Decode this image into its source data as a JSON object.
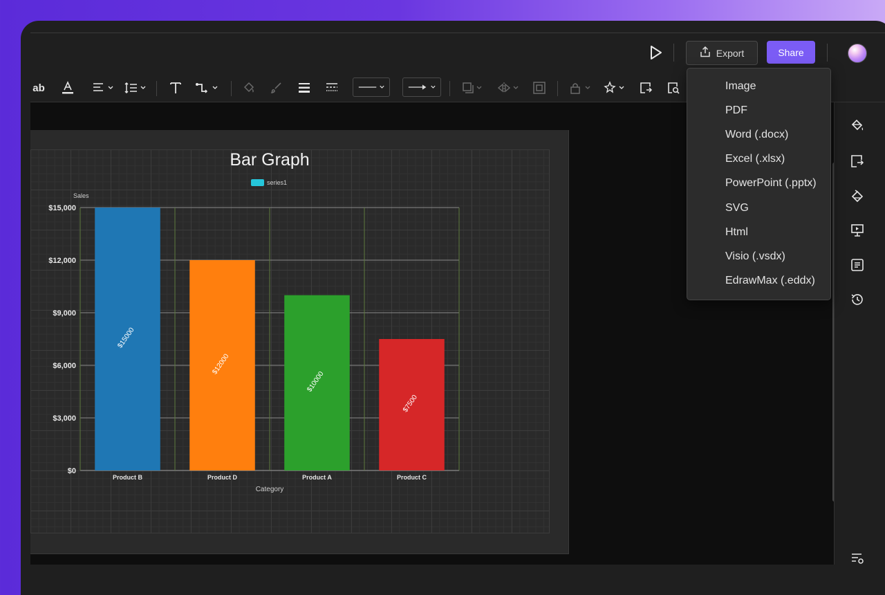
{
  "header": {
    "export_label": "Export",
    "share_label": "Share"
  },
  "export_menu": [
    "Image",
    "PDF",
    "Word (.docx)",
    "Excel (.xlsx)",
    "PowerPoint (.pptx)",
    "SVG",
    "Html",
    "Visio (.vsdx)",
    "EdrawMax (.eddx)"
  ],
  "toolbar": {
    "text_style_label": "ab"
  },
  "chart_data": {
    "type": "bar",
    "title": "Bar Graph",
    "ylabel": "Sales",
    "xlabel": "Category",
    "categories": [
      "Product B",
      "Product D",
      "Product A",
      "Product C"
    ],
    "series": [
      {
        "name": "series1",
        "values": [
          15000,
          12000,
          10000,
          7500
        ]
      }
    ],
    "data_labels": [
      "$15000",
      "$12000",
      "$10000",
      "$7500"
    ],
    "bar_colors": [
      "#1f77b4",
      "#ff7f0e",
      "#2ca02c",
      "#d62728"
    ],
    "legend_color": "#26c6da",
    "yticks": [
      "$0",
      "$3,000",
      "$6,000",
      "$9,000",
      "$12,000",
      "$15,000"
    ],
    "ylim": [
      0,
      15000
    ],
    "legend_position": "top-center",
    "grid": true
  }
}
